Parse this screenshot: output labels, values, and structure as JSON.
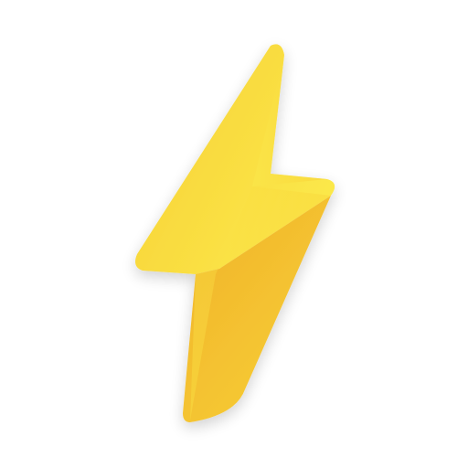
{
  "icon": {
    "name": "lightning-bolt-icon",
    "colors": {
      "background": "#ffffff",
      "bolt_light": "#fbe84a",
      "bolt_mid": "#f7cf35",
      "bolt_deep": "#f0b12a",
      "shadow": "#000000"
    }
  }
}
